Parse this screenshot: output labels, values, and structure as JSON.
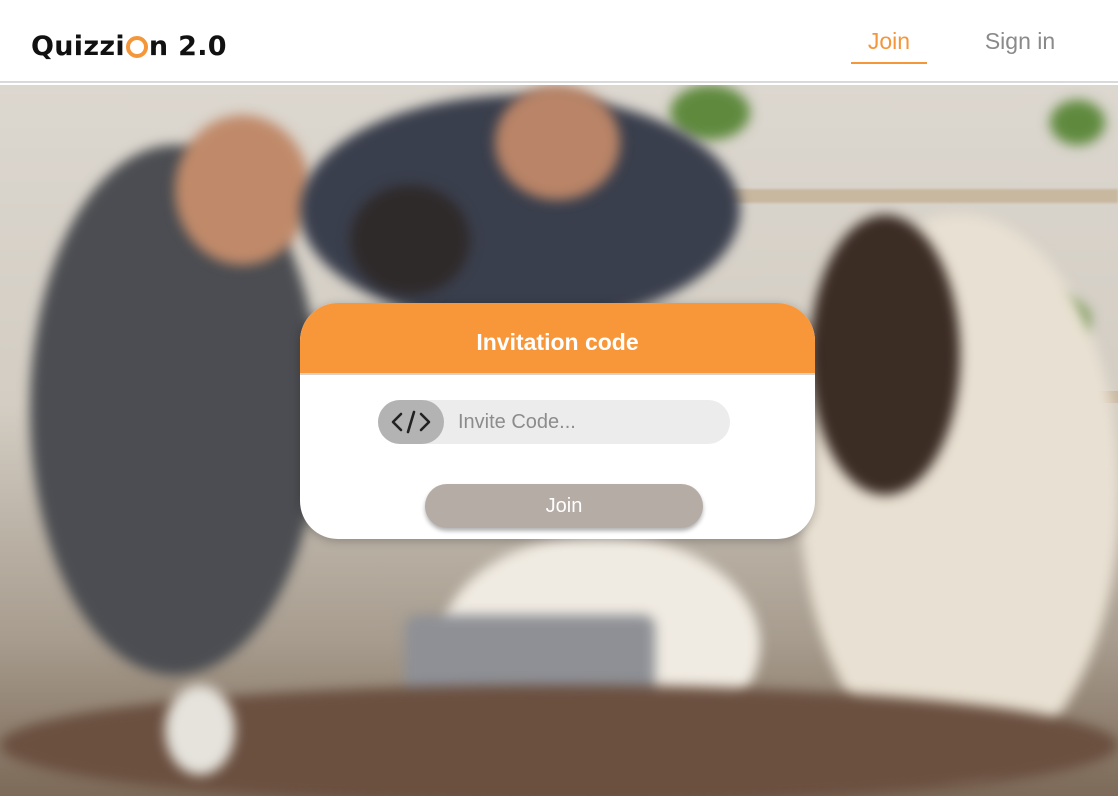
{
  "header": {
    "logo_prefix": "Quizzi",
    "logo_suffix": "n 2.0",
    "nav": {
      "join_label": "Join",
      "signin_label": "Sign in"
    }
  },
  "modal": {
    "title": "Invitation code",
    "code_input": {
      "placeholder": "Invite Code...",
      "value": ""
    },
    "code_icon": "code-brackets-icon",
    "join_label": "Join"
  },
  "colors": {
    "accent": "#f8963a",
    "button": "#b5aca5",
    "nav_inactive": "#8a8a8a"
  }
}
